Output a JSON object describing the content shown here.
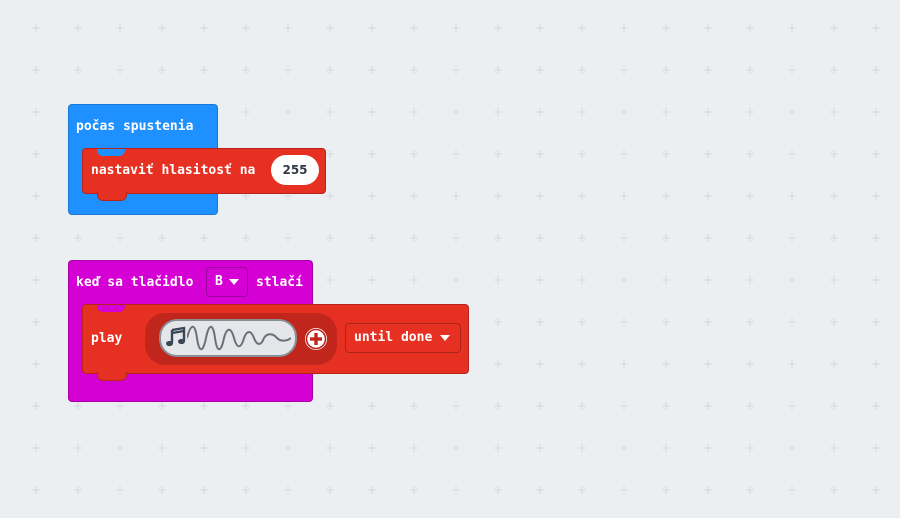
{
  "blocks": {
    "on_start": {
      "label": "počas spustenia",
      "color": "#1e90ff",
      "set_volume": {
        "label": "nastaviť hlasitosť na",
        "value": "255",
        "color": "#e63022"
      }
    },
    "on_button": {
      "label_before": "keď sa tlačidlo",
      "button_value": "B",
      "label_after": "stlačí",
      "color": "#d400d4",
      "play": {
        "label": "play",
        "melody_icon": "music-note-icon",
        "wave_icon": "sound-wave-icon",
        "add_icon": "plus-circle-icon",
        "mode_value": "until done",
        "color": "#e63022"
      }
    }
  }
}
